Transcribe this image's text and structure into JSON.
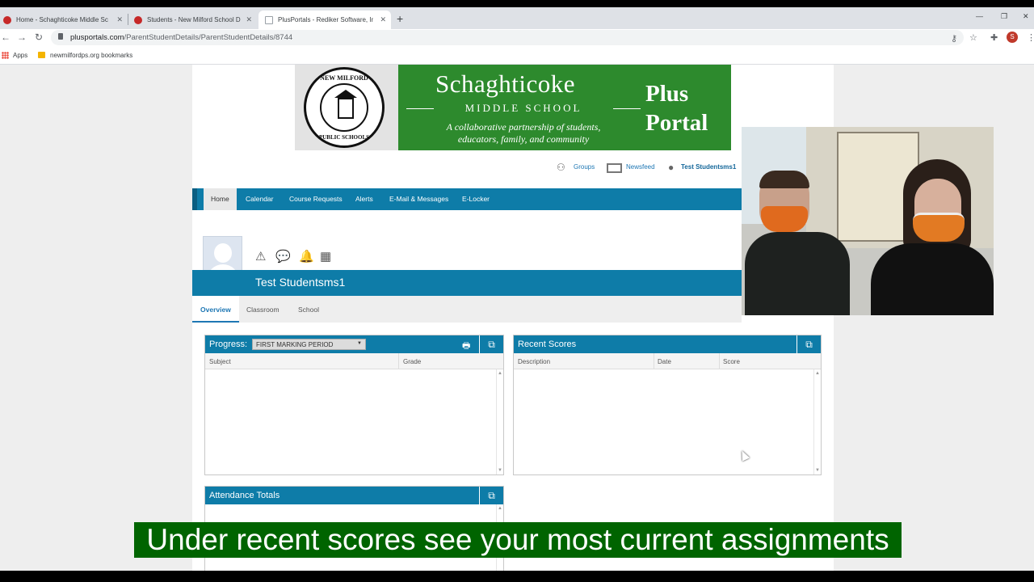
{
  "browser": {
    "tabs": [
      {
        "title": "Home - Schaghticoke Middle Sc"
      },
      {
        "title": "Students - New Milford School D"
      },
      {
        "title": "PlusPortals - Rediker Software, In"
      }
    ],
    "url_host": "plusportals.com",
    "url_path": "/ParentStudentDetails/ParentStudentDetails/8744",
    "profile_initial": "S",
    "bookmarks": [
      "Apps",
      "newmilfordps.org bookmarks"
    ]
  },
  "banner": {
    "seal_top": "NEW MILFORD",
    "seal_bottom": "PUBLIC SCHOOLS",
    "school_name": "Schaghticoke",
    "school_sub": "MIDDLE SCHOOL",
    "tagline": "A collaborative partnership of students, educators, family, and community",
    "plus": "Plus",
    "portal": "Portal"
  },
  "utility": {
    "groups": "Groups",
    "newsfeed": "Newsfeed",
    "user": "Test Studentsms1"
  },
  "nav": [
    "Home",
    "Calendar",
    "Course Requests",
    "Alerts",
    "E-Mail & Messages",
    "E-Locker"
  ],
  "student": {
    "name": "Test Studentsms1",
    "tabs": [
      "Overview",
      "Classroom",
      "School"
    ]
  },
  "progress": {
    "title": "Progress:",
    "period": "FIRST MARKING PERIOD",
    "columns": [
      "Subject",
      "Grade"
    ]
  },
  "recent_scores": {
    "title": "Recent Scores",
    "columns": [
      "Description",
      "Date",
      "Score"
    ]
  },
  "attendance": {
    "title": "Attendance Totals"
  },
  "caption": "Under recent scores see your most current assignments",
  "colors": {
    "accent": "#0e7ca8",
    "banner_green": "#2d8a2d",
    "caption_bg": "#006400"
  }
}
